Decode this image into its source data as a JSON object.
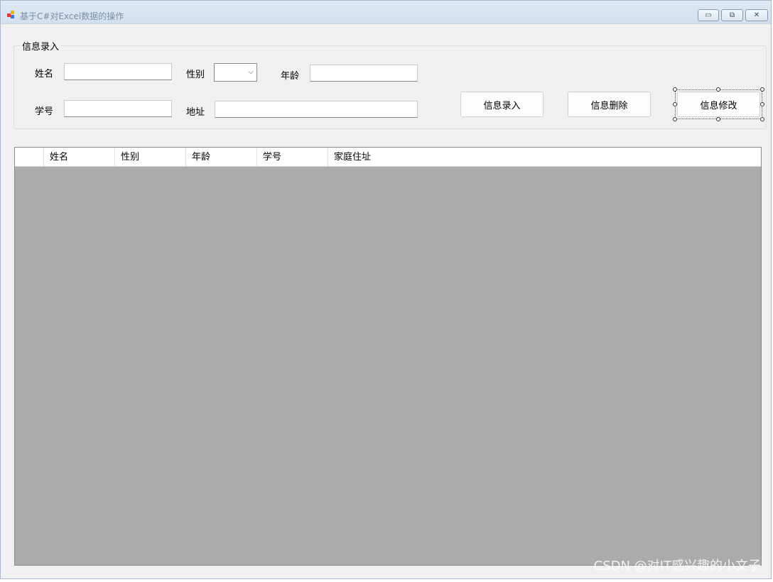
{
  "window": {
    "title": "基于C#对Excel数据的操作",
    "controls": {
      "minimize": "▭",
      "restore": "⧉",
      "close": "✕"
    }
  },
  "form": {
    "group_title": "信息录入",
    "name_label": "姓名",
    "name_value": "",
    "gender_label": "性别",
    "gender_value": "",
    "age_label": "年龄",
    "age_value": "",
    "student_id_label": "学号",
    "student_id_value": "",
    "address_label": "地址",
    "address_value": ""
  },
  "buttons": {
    "add": "信息录入",
    "delete": "信息删除",
    "edit": "信息修改"
  },
  "grid": {
    "columns": [
      "姓名",
      "性别",
      "年龄",
      "学号",
      "家庭住址"
    ],
    "rows": []
  },
  "watermark": "CSDN @对IT感兴趣的小文子",
  "colors": {
    "grid_background": "#ababab",
    "form_background": "#f0f0f0",
    "titlebar": "#dfe9f5"
  }
}
